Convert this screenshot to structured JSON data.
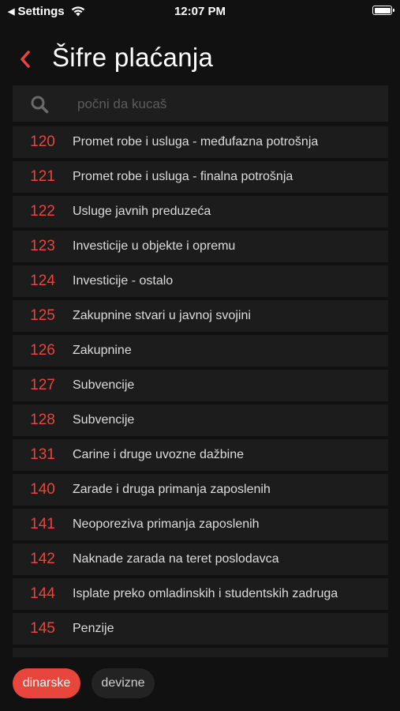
{
  "status_bar": {
    "back_label": "Settings",
    "time": "12:07 PM"
  },
  "header": {
    "title": "Šifre plaćanja"
  },
  "search": {
    "placeholder": "počni da kucaš",
    "value": ""
  },
  "items": [
    {
      "code": "120",
      "label": "Promet robe i usluga - međufazna potrošnja"
    },
    {
      "code": "121",
      "label": "Promet robe i usluga - finalna potrošnja"
    },
    {
      "code": "122",
      "label": "Usluge javnih preduzeća"
    },
    {
      "code": "123",
      "label": "Investicije u objekte i opremu"
    },
    {
      "code": "124",
      "label": "Investicije - ostalo"
    },
    {
      "code": "125",
      "label": "Zakupnine stvari u javnoj svojini"
    },
    {
      "code": "126",
      "label": "Zakupnine"
    },
    {
      "code": "127",
      "label": "Subvencije"
    },
    {
      "code": "128",
      "label": "Subvencije"
    },
    {
      "code": "131",
      "label": "Carine i druge uvozne dažbine"
    },
    {
      "code": "140",
      "label": "Zarade i druga primanja zaposlenih"
    },
    {
      "code": "141",
      "label": "Neoporeziva primanja zaposlenih"
    },
    {
      "code": "142",
      "label": "Naknade zarada na teret poslodavca"
    },
    {
      "code": "144",
      "label": "Isplate preko omladinskih i studentskih zadruga"
    },
    {
      "code": "145",
      "label": "Penzije"
    }
  ],
  "filters": {
    "dinarske": "dinarske",
    "devizne": "devizne",
    "selected": "dinarske"
  },
  "colors": {
    "accent": "#e8453c",
    "background": "#111111",
    "row": "#1c1c1c"
  }
}
